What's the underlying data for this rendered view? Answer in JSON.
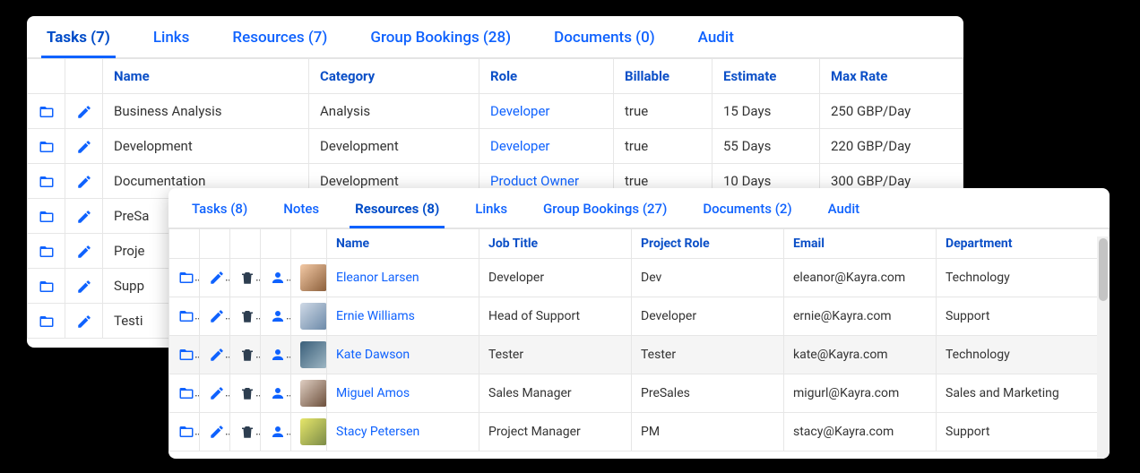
{
  "back": {
    "tabs": [
      {
        "label": "Tasks (7)",
        "active": true
      },
      {
        "label": "Links"
      },
      {
        "label": "Resources (7)"
      },
      {
        "label": "Group Bookings (28)"
      },
      {
        "label": "Documents (0)"
      },
      {
        "label": "Audit"
      }
    ],
    "columns": [
      "Name",
      "Category",
      "Role",
      "Billable",
      "Estimate",
      "Max Rate"
    ],
    "rows": [
      {
        "name": "Business Analysis",
        "category": "Analysis",
        "role": "Developer",
        "billable": "true",
        "estimate": "15 Days",
        "maxrate": "250 GBP/Day"
      },
      {
        "name": "Development",
        "category": "Development",
        "role": "Developer",
        "billable": "true",
        "estimate": "55 Days",
        "maxrate": "220 GBP/Day"
      },
      {
        "name": "Documentation",
        "category": "Development",
        "role": "Product Owner",
        "billable": "true",
        "estimate": "10 Days",
        "maxrate": "300 GBP/Day"
      },
      {
        "name": "PreSa",
        "category": "",
        "role": "",
        "billable": "",
        "estimate": "",
        "maxrate": ""
      },
      {
        "name": "Proje",
        "category": "",
        "role": "",
        "billable": "",
        "estimate": "",
        "maxrate": ""
      },
      {
        "name": "Supp",
        "category": "",
        "role": "",
        "billable": "",
        "estimate": "",
        "maxrate": ""
      },
      {
        "name": "Testi",
        "category": "",
        "role": "",
        "billable": "",
        "estimate": "",
        "maxrate": ""
      }
    ]
  },
  "front": {
    "tabs": [
      {
        "label": "Tasks (8)"
      },
      {
        "label": "Notes"
      },
      {
        "label": "Resources (8)",
        "active": true
      },
      {
        "label": "Links"
      },
      {
        "label": "Group Bookings (27)"
      },
      {
        "label": "Documents (2)"
      },
      {
        "label": "Audit"
      }
    ],
    "columns": [
      "Name",
      "Job Title",
      "Project Role",
      "Email",
      "Department"
    ],
    "rows": [
      {
        "name": "Eleanor Larsen",
        "title": "Developer",
        "role": "Dev",
        "email": "eleanor@Kayra.com",
        "dept": "Technology",
        "avatar": "a"
      },
      {
        "name": "Ernie Williams",
        "title": "Head of Support",
        "role": "Developer",
        "email": "ernie@Kayra.com",
        "dept": "Support",
        "avatar": "b"
      },
      {
        "name": "Kate Dawson",
        "title": "Tester",
        "role": "Tester",
        "email": "kate@Kayra.com",
        "dept": "Technology",
        "avatar": "c",
        "alt": true
      },
      {
        "name": "Miguel Amos",
        "title": "Sales Manager",
        "role": "PreSales",
        "email": "migurl@Kayra.com",
        "dept": "Sales and Marketing",
        "avatar": "d"
      },
      {
        "name": "Stacy Petersen",
        "title": "Project Manager",
        "role": "PM",
        "email": "stacy@Kayra.com",
        "dept": "Support",
        "avatar": "e"
      }
    ]
  }
}
